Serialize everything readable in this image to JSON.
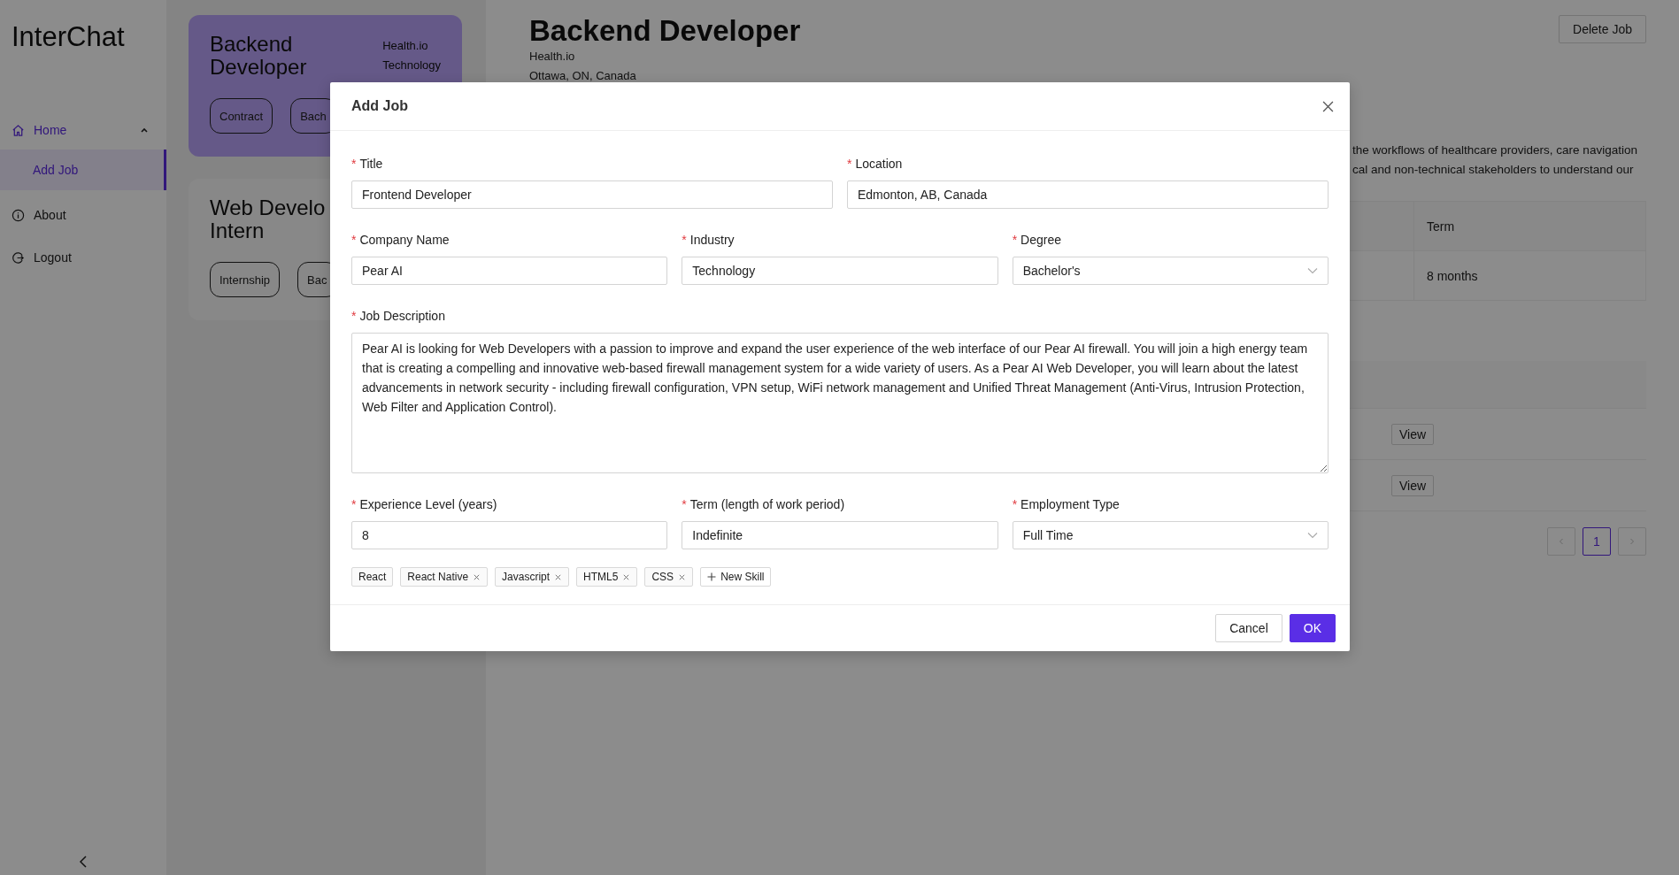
{
  "sidebar": {
    "logo": "InterChat",
    "items": [
      {
        "label": "Home",
        "kind": "home",
        "selected": false,
        "expanded": true,
        "children": [
          {
            "label": "Add Job",
            "selected": true
          }
        ]
      },
      {
        "label": "About",
        "kind": "info",
        "selected": false
      },
      {
        "label": "Logout",
        "kind": "logout",
        "selected": false
      }
    ]
  },
  "job_cards": [
    {
      "title_lines": [
        "Backend",
        "Developer"
      ],
      "company": "Health.io",
      "industry": "Technology",
      "tags": [
        "Contract",
        "Bach"
      ],
      "selected": true
    },
    {
      "title_lines": [
        "Web Develo",
        "Intern"
      ],
      "tags": [
        "Internship",
        "Bac"
      ],
      "selected": false
    }
  ],
  "job_detail": {
    "title": "Backend Developer",
    "company": "Health.io",
    "location": "Ottawa, ON, Canada",
    "delete_button": "Delete Job",
    "description_fragments": [
      "the workflows of healthcare providers, care navigation",
      "cal and non-technical stakeholders to understand our"
    ],
    "table": {
      "columns": [
        "Term"
      ],
      "rows": [
        [
          "8 months"
        ]
      ]
    },
    "applicants": {
      "rows": [
        {
          "action": "View"
        },
        {
          "action": "View"
        }
      ]
    },
    "pagination": {
      "prev_disabled": true,
      "next_disabled": true,
      "pages": [
        {
          "label": "1",
          "selected": true
        }
      ]
    }
  },
  "modal": {
    "title": "Add Job",
    "rows": [
      {
        "fields": [
          {
            "label": "Title",
            "value": "Frontend Developer",
            "kind": "text",
            "required_mark": "*"
          },
          {
            "label": "Location",
            "value": "Edmonton, AB, Canada",
            "kind": "text",
            "required_mark": "*"
          }
        ]
      },
      {
        "fields": [
          {
            "label": "Company Name",
            "value": "Pear AI",
            "kind": "text",
            "required_mark": "*"
          },
          {
            "label": "Industry",
            "value": "Technology",
            "kind": "text",
            "required_mark": "*"
          },
          {
            "label": "Degree",
            "value": "Bachelor's",
            "kind": "select",
            "required_mark": "*"
          }
        ]
      },
      {
        "fields": [
          {
            "label": "Job Description",
            "value": "Pear AI is looking for Web Developers with a passion to improve and expand the user experience of the web interface of our Pear AI firewall. You will join a high energy team that is creating a compelling and innovative web-based firewall management system for a wide variety of users. As a Pear AI Web Developer, you will learn about the latest advancements in network security - including firewall configuration, VPN setup, WiFi network management and Unified Threat Management (Anti-Virus, Intrusion Protection, Web Filter and Application Control).",
            "kind": "textarea",
            "required_mark": "*"
          }
        ]
      },
      {
        "fields": [
          {
            "label": "Experience Level (years)",
            "value": "8",
            "kind": "text",
            "required_mark": "*"
          },
          {
            "label": "Term (length of work period)",
            "value": "Indefinite",
            "kind": "text",
            "required_mark": "*"
          },
          {
            "label": "Employment Type",
            "value": "Full Time",
            "kind": "select",
            "required_mark": "*"
          }
        ]
      }
    ],
    "skills": [
      {
        "label": "React",
        "removable": false
      },
      {
        "label": "React Native",
        "removable": true
      },
      {
        "label": "Javascript",
        "removable": true
      },
      {
        "label": "HTML5",
        "removable": true
      },
      {
        "label": "CSS",
        "removable": true
      }
    ],
    "new_skill": "New Skill",
    "buttons": [
      {
        "label": "Cancel",
        "kind": "default"
      },
      {
        "label": "OK",
        "kind": "primary"
      }
    ]
  }
}
